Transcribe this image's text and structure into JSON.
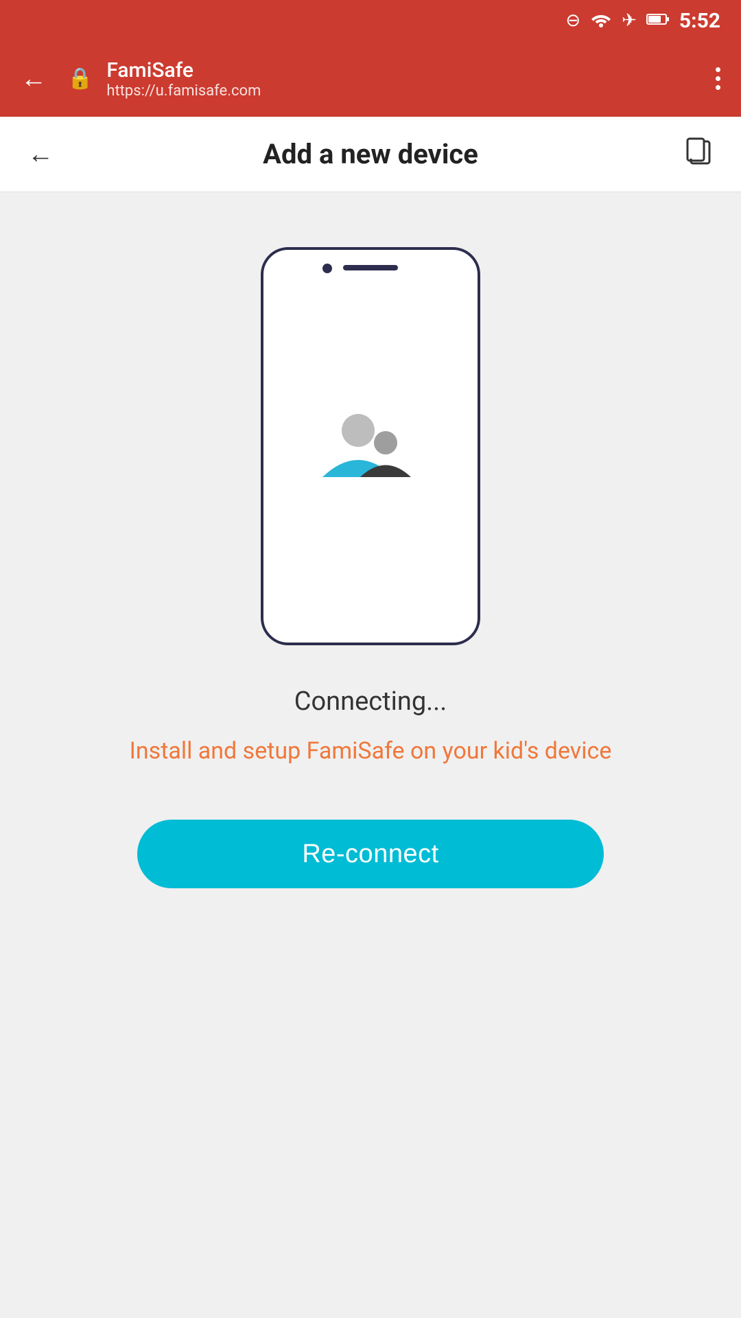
{
  "status_bar": {
    "time": "5:52",
    "icons": [
      "minus-circle-icon",
      "wifi-icon",
      "airplane-icon",
      "battery-icon"
    ]
  },
  "browser_bar": {
    "title": "FamiSafe",
    "url": "https://u.famisafe.com",
    "back_label": "←",
    "menu_label": "⋮"
  },
  "page_header": {
    "title": "Add a new device",
    "back_label": "←",
    "share_label": "⎋"
  },
  "main": {
    "connecting_text": "Connecting...",
    "install_link": "Install and setup FamiSafe on your kid's device",
    "reconnect_button": "Re-connect"
  }
}
